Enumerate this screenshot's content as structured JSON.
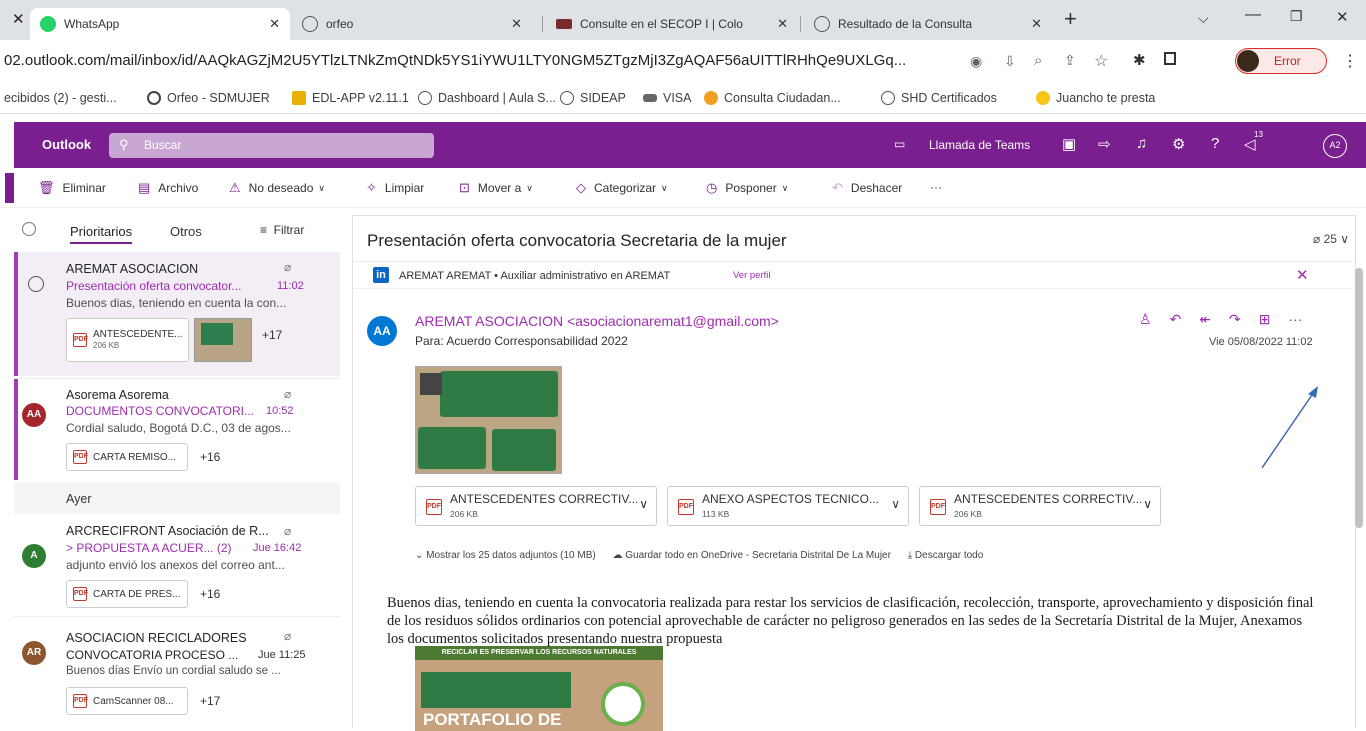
{
  "browser": {
    "tabs": [
      {
        "title": "WhatsApp"
      },
      {
        "title": "orfeo"
      },
      {
        "title": "Consulte en el SECOP I | Colo"
      },
      {
        "title": "Resultado de la Consulta"
      }
    ],
    "url": "02.outlook.com/mail/inbox/id/AAQkAGZjM2U5YTlzLTNkZmQtNDk5YS1iYWU1LTY0NGM5ZTgzMjI3ZgAQAF56aUITTlRHhQe9UXLGq...",
    "profile_label": "Error",
    "bookmarks": [
      "ecibidos (2) - gesti...",
      "Orfeo - SDMUJER",
      "EDL-APP v2.11.1",
      "Dashboard | Aula S...",
      "SIDEAP",
      "VISA",
      "Consulta Ciudadan...",
      "SHD Certificados",
      "Juancho te presta"
    ]
  },
  "outlook": {
    "brand": "Outlook",
    "search_placeholder": "Buscar",
    "teams_call": "Llamada de Teams",
    "notif_count": "13",
    "avatar": "A2",
    "accent": "#7a1f8f"
  },
  "toolbar": [
    "Eliminar",
    "Archivo",
    "No deseado",
    "Limpiar",
    "Mover a",
    "Categorizar",
    "Posponer",
    "Deshacer"
  ],
  "list": {
    "tab_focused": "Prioritarios",
    "tab_other": "Otros",
    "filter": "Filtrar",
    "group_yesterday": "Ayer",
    "messages": [
      {
        "sender": "AREMAT ASOCIACION",
        "subject": "Presentación oferta convocator...",
        "time": "11:02",
        "preview": "Buenos dias, teniendo en cuenta la con...",
        "attachment": "ANTESCEDENTE...",
        "attachment_size": "206 KB",
        "more": "+17"
      },
      {
        "avatar": "AA",
        "sender": "Asorema Asorema",
        "subject": "DOCUMENTOS CONVOCATORI...",
        "time": "10:52",
        "preview": "Cordial saludo, Bogotá D.C., 03 de agos...",
        "attachment": "CARTA REMISO...",
        "more": "+16"
      },
      {
        "avatar": "A",
        "sender": "ARCRECIFRONT Asociación de R...",
        "subject": "> PROPUESTA A ACUER...",
        "count": "(2)",
        "time": "Jue 16:42",
        "preview": "adjunto envió los anexos del correo ant...",
        "attachment": "CARTA DE PRES...",
        "more": "+16"
      },
      {
        "avatar": "AR",
        "sender": "ASOCIACION RECICLADORES",
        "subject": "CONVOCATORIA PROCESO ...",
        "time": "Jue 11:25",
        "preview": "Buenos días Envío un cordial saludo se ...",
        "attachment": "CamScanner 08...",
        "more": "+17"
      }
    ]
  },
  "reading": {
    "subject": "Presentación oferta convocatoria Secretaria de la mujer",
    "attach_count": "25",
    "linkedin_text": "AREMAT AREMAT • Auxiliar administrativo en AREMAT",
    "linkedin_link": "Ver perfil",
    "from_avatar": "AA",
    "from": "AREMAT ASOCIACION <asociacionaremat1@gmail.com>",
    "to": "Para:  Acuerdo Corresponsabilidad 2022",
    "date": "Vie 05/08/2022 11:02",
    "attachments": [
      {
        "name": "ANTESCEDENTES CORRECTIV...",
        "size": "206 KB"
      },
      {
        "name": "ANEXO ASPECTOS TECNICO...",
        "size": "113 KB"
      },
      {
        "name": "ANTESCEDENTES CORRECTIV...",
        "size": "206 KB"
      }
    ],
    "show_all": "Mostrar los 25 datos adjuntos (10 MB)",
    "save_onedrive": "Guardar todo en OneDrive - Secretaria Distrital De La Mujer",
    "download_all": "Descargar todo",
    "body": "Buenos dias, teniendo en cuenta la convocatoria realizada para restar los servicios de clasificación, recolección, transporte, aprovechamiento y disposición final de los residuos sólidos ordinarios con potencial aprovechable de carácter no peligroso generados en las sedes de la Secretaría Distrital de la Mujer, Anexamos los documentos solicitados presentando nuestra propuesta",
    "banner_text": "RECICLAR ES PRESERVAR LOS RECURSOS NATURALES",
    "portfolio_text": "PORTAFOLIO DE"
  }
}
